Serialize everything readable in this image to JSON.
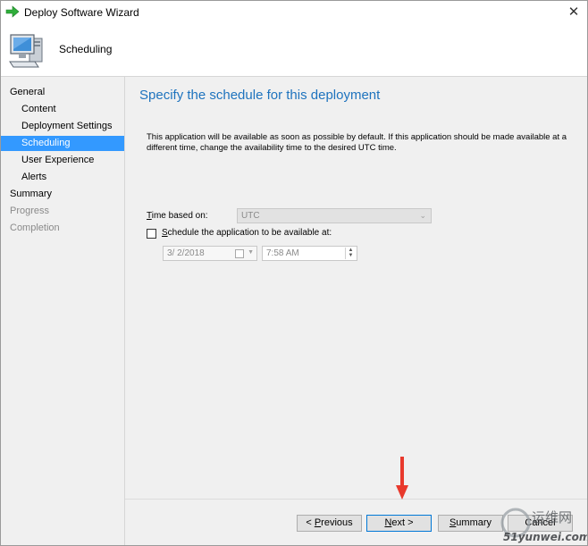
{
  "window": {
    "title": "Deploy Software Wizard",
    "close_glyph": "✕"
  },
  "header": {
    "title": "Scheduling",
    "icon": "computer-monitor-icon"
  },
  "nav": {
    "items": [
      {
        "label": "General"
      },
      {
        "label": "Content"
      },
      {
        "label": "Deployment Settings"
      },
      {
        "label": "Scheduling"
      },
      {
        "label": "User Experience"
      },
      {
        "label": "Alerts"
      },
      {
        "label": "Summary"
      },
      {
        "label": "Progress"
      },
      {
        "label": "Completion"
      }
    ],
    "selected": "Scheduling"
  },
  "main": {
    "heading": "Specify the schedule for this deployment",
    "description": "This application will be available as soon as possible by default. If this application should be made available at a different time, change the availability time to the desired UTC time.",
    "time_based_on": {
      "label_accesskey": "T",
      "label_rest": "ime based on:",
      "value": "UTC"
    },
    "schedule_checkbox": {
      "accesskey": "S",
      "label_rest": "chedule the application to be available at:",
      "checked": false
    },
    "date": "3/  2/2018",
    "time": "7:58 AM"
  },
  "footer": {
    "previous": {
      "prefix": "< ",
      "accesskey": "P",
      "rest": "revious"
    },
    "next": {
      "accesskey": "N",
      "rest": "ext >"
    },
    "summary": {
      "accesskey": "S",
      "rest": "ummary"
    },
    "cancel": "Cancel"
  },
  "watermark": {
    "line1": "运维网",
    "line2": "51yunwei.com"
  },
  "colors": {
    "accent": "#1e73be",
    "selection": "#3399ff",
    "arrow": "#e8392c"
  }
}
